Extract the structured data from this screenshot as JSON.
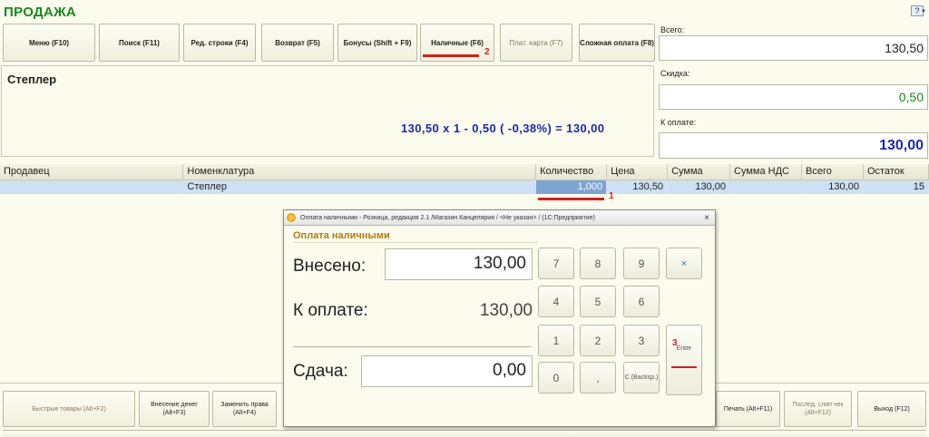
{
  "header": {
    "title": "ПРОДАЖА",
    "help_label": "?"
  },
  "toolbar": {
    "buttons": [
      {
        "label": "Меню (F10)"
      },
      {
        "label": "Поиск (F11)"
      },
      {
        "label": "Ред. строки (F4)"
      },
      {
        "label": "Возврат (F5)"
      },
      {
        "label": "Бонусы (Shift + F9)"
      },
      {
        "label": "Наличные (F6)"
      },
      {
        "label": "Плат. карта (F7)"
      },
      {
        "label": "Сложная оплата (F8)"
      }
    ]
  },
  "summary": {
    "total_label": "Всего:",
    "total_value": "130,50",
    "discount_label": "Скидка:",
    "discount_value": "0,50",
    "due_label": "К оплате:",
    "due_value": "130,00"
  },
  "product": {
    "name": "Степлер",
    "formula": "130,50  x 1  - 0,50  ( -0,38%)  = 130,00"
  },
  "table": {
    "headers": [
      "Продавец",
      "Номенклатура",
      "Количество",
      "Цена",
      "Сумма",
      "Сумма НДС",
      "Всего",
      "Остаток"
    ],
    "rows": [
      {
        "seller": "",
        "item": "Степлер",
        "qty": "1,000",
        "price": "130,50",
        "sum": "130,00",
        "vat": "",
        "total": "130,00",
        "stock": "15"
      }
    ]
  },
  "bottom_buttons": [
    {
      "label": "Быстрые товары (Alt+F2)"
    },
    {
      "label": "Внесение денег (Alt+F3)"
    },
    {
      "label": "Заменить права (Alt+F4)"
    },
    {
      "label": "Печать (Alt+F11)"
    },
    {
      "label": "Послед. слип чек (Alt+F12)"
    },
    {
      "label": "Выход (F12)"
    }
  ],
  "annotations": [
    "1",
    "2",
    "3"
  ],
  "dialog": {
    "window_title": "Оплата наличными - Розница, редакция 2.1 /Магазин Канцелярия / <Не указан> /  (1С:Предприятие)",
    "close_label": "×",
    "heading": "Оплата наличными",
    "paid_label": "Внесено:",
    "paid_value": "130,00",
    "due_label": "К оплате:",
    "due_value": "130,00",
    "change_label": "Сдача:",
    "change_value": "0,00",
    "keypad": {
      "k7": "7",
      "k8": "8",
      "k9": "9",
      "kx": "×",
      "k4": "4",
      "k5": "5",
      "k6": "6",
      "k1": "1",
      "k2": "2",
      "k3": "3",
      "k0": "0",
      "kdot": ",",
      "kc": "C (Backsp.)",
      "enter": "Enter"
    }
  },
  "colors": {
    "title_green": "#1a8a1a",
    "due_blue": "#1a2aa8",
    "discount_green": "#1a8a1a",
    "annotation_red": "#d21f1f",
    "selection_blue": "#cde0f4"
  }
}
